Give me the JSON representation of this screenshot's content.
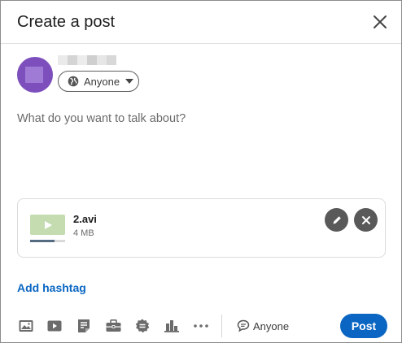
{
  "dialog": {
    "title": "Create a post",
    "close_icon": "close-icon"
  },
  "author": {
    "audience_label": "Anyone",
    "audience_icon": "globe-icon"
  },
  "composer": {
    "placeholder": "What do you want to talk about?"
  },
  "attachment": {
    "file_name": "2.avi",
    "file_size": "4 MB",
    "upload_progress": 0.7,
    "edit_icon": "pencil-icon",
    "remove_icon": "close-icon"
  },
  "hashtag_label": "Add hashtag",
  "toolbar": {
    "tools": [
      "photo-icon",
      "video-icon",
      "document-icon",
      "job-icon",
      "celebrate-icon",
      "poll-icon",
      "more-icon"
    ],
    "comment_setting_label": "Anyone",
    "post_label": "Post"
  },
  "colors": {
    "accent": "#0a66c2",
    "avatar": "#7d4fbd"
  }
}
